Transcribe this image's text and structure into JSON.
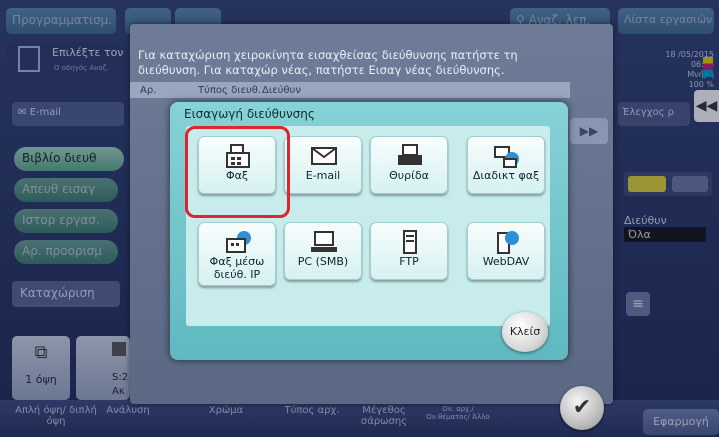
{
  "top": {
    "programming_tab": "Προγραμματισμ.",
    "search_placeholder": "Αναζ. λεπ.",
    "job_list": "Λίστα εργασιών"
  },
  "left": {
    "instruction": "Επιλέξτε τον",
    "guide_hint": "Ο οδηγός Αναζ.",
    "email_tab": "E-mail",
    "pills": [
      "Βιβλίο διευθ",
      "Απευθ εισαγ",
      "Ιστορ εργασ.",
      "Αρ. προορισμ",
      "Καταχώριση"
    ]
  },
  "message": {
    "line1": "Για καταχώριση χειροκίνητα εισαχθείσας διεύθυνσης πατήστε τη",
    "line2": "διεύθυνση. Για καταχώρ νέας, πατήστε Εισαγ νέας διεύθυνσης.",
    "col_ar": "Αρ.",
    "col_type": "Τύπος διευθ.",
    "col_addr": "Διεύθυν"
  },
  "status": {
    "date": "18 /05/2015",
    "time": "06:46",
    "memory_label": "Μνήμη",
    "memory_value": "100 %",
    "check_label": "Έλεγχος ρ"
  },
  "right": {
    "address_label": "Διεύθυν",
    "address_value": "Όλα"
  },
  "dialog": {
    "title": "Εισαγωγή διεύθυνσης",
    "tiles": [
      "Φαξ",
      "E-mail",
      "Θυρίδα",
      "Διαδικτ φαξ",
      "Φαξ μέσω διεύθ. IP",
      "PC (SMB)",
      "FTP",
      "WebDAV"
    ],
    "close": "Κλείσ"
  },
  "bottom": {
    "copies": "1 όψη",
    "s_label": "S:2",
    "ak_label": "Ακ",
    "items": [
      "Απλή όψη/ διπλή όψη",
      "Ανάλυση",
      "Χρώμα",
      "Τύπος αρχ.",
      "Μέγεθος σάρωσης",
      "Ον. αρχ./ Ον.θέματος/ Άλλο"
    ],
    "apply": "Εφαρμογή"
  },
  "colors": {
    "highlight": "#e0232d",
    "dialog_bg": "#86d2d6",
    "pill_active": "#a4d8c0"
  }
}
